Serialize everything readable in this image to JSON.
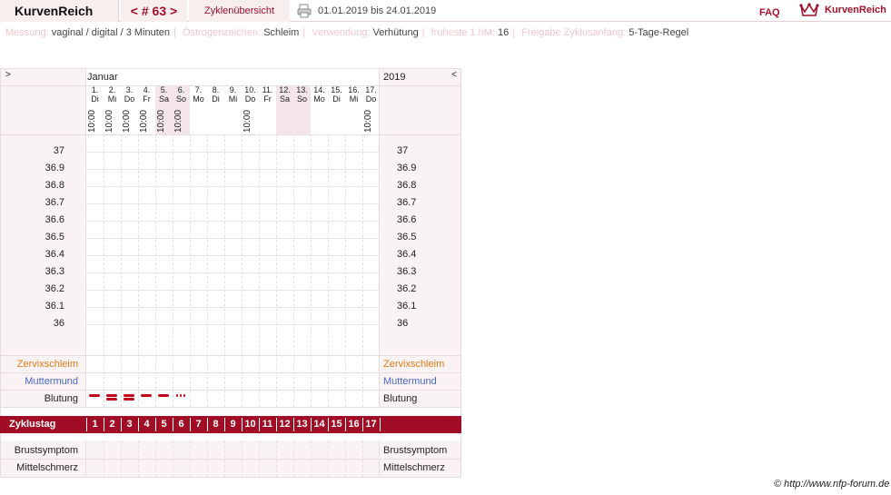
{
  "header": {
    "logo": "KurvenReich",
    "cycle_nav": "< # 63 >",
    "overview": "Zyklenübersicht",
    "date_range": "01.01.2019 bis 24.01.2019",
    "faq": "FAQ",
    "brand": "KurvenReich"
  },
  "settings": {
    "measure_label": "Messung:",
    "measure_value": "vaginal / digital / 3 Minuten",
    "estrogen_label": "Östrogenzeichen:",
    "estrogen_value": "Schleim",
    "usage_label": "Verwendung:",
    "usage_value": "Verhütung",
    "earliest_label": "früheste 1.hM:",
    "earliest_value": "16",
    "release_label": "Freigabe Zyklusanfang:",
    "release_value": "5-Tage-Regel"
  },
  "chart": {
    "prev_arrow": ">",
    "next_arrow": "<",
    "month": "Januar",
    "year": "2019",
    "days": [
      {
        "d": "1.",
        "w": "Di",
        "t": "10:00",
        "we": false
      },
      {
        "d": "2.",
        "w": "Mi",
        "t": "10:00",
        "we": false
      },
      {
        "d": "3.",
        "w": "Do",
        "t": "10:00",
        "we": false
      },
      {
        "d": "4.",
        "w": "Fr",
        "t": "10:00",
        "we": false
      },
      {
        "d": "5.",
        "w": "Sa",
        "t": "10:00",
        "we": true
      },
      {
        "d": "6.",
        "w": "So",
        "t": "10:00",
        "we": true
      },
      {
        "d": "7.",
        "w": "Mo",
        "t": "",
        "we": false
      },
      {
        "d": "8.",
        "w": "Di",
        "t": "",
        "we": false
      },
      {
        "d": "9.",
        "w": "Mi",
        "t": "",
        "we": false
      },
      {
        "d": "10.",
        "w": "Do",
        "t": "10:00",
        "we": false
      },
      {
        "d": "11.",
        "w": "Fr",
        "t": "",
        "we": false
      },
      {
        "d": "12.",
        "w": "Sa",
        "t": "",
        "we": true
      },
      {
        "d": "13.",
        "w": "So",
        "t": "",
        "we": true
      },
      {
        "d": "14.",
        "w": "Mo",
        "t": "",
        "we": false
      },
      {
        "d": "15.",
        "w": "Di",
        "t": "",
        "we": false
      },
      {
        "d": "16.",
        "w": "Mi",
        "t": "",
        "we": false
      },
      {
        "d": "17.",
        "w": "Do",
        "t": "10:00",
        "we": false
      }
    ],
    "temps": [
      "37",
      "36.9",
      "36.8",
      "36.7",
      "36.6",
      "36.5",
      "36.4",
      "36.3",
      "36.2",
      "36.1",
      "36"
    ],
    "rows": {
      "cervical_mucus": "Zervixschleim",
      "cervix": "Muttermund",
      "bleeding": "Blutung",
      "cycle_day": "Zyklustag",
      "breast": "Brustsymptom",
      "mittelschmerz": "Mittelschmerz"
    },
    "bleeding_days": [
      {
        "day": 1,
        "type": "dash"
      },
      {
        "day": 2,
        "type": "double"
      },
      {
        "day": 3,
        "type": "double"
      },
      {
        "day": 4,
        "type": "dash"
      },
      {
        "day": 5,
        "type": "dash"
      },
      {
        "day": 6,
        "type": "dots"
      }
    ],
    "cycle_days": [
      "1",
      "2",
      "3",
      "4",
      "5",
      "6",
      "7",
      "8",
      "9",
      "10",
      "11",
      "12",
      "13",
      "14",
      "15",
      "16",
      "17"
    ]
  },
  "colors": {
    "accent": "#a00d25",
    "mucus": "#e07b1a",
    "cervix": "#4a67c9"
  },
  "footer": {
    "copyright": "© http://www.nfp-forum.de"
  }
}
